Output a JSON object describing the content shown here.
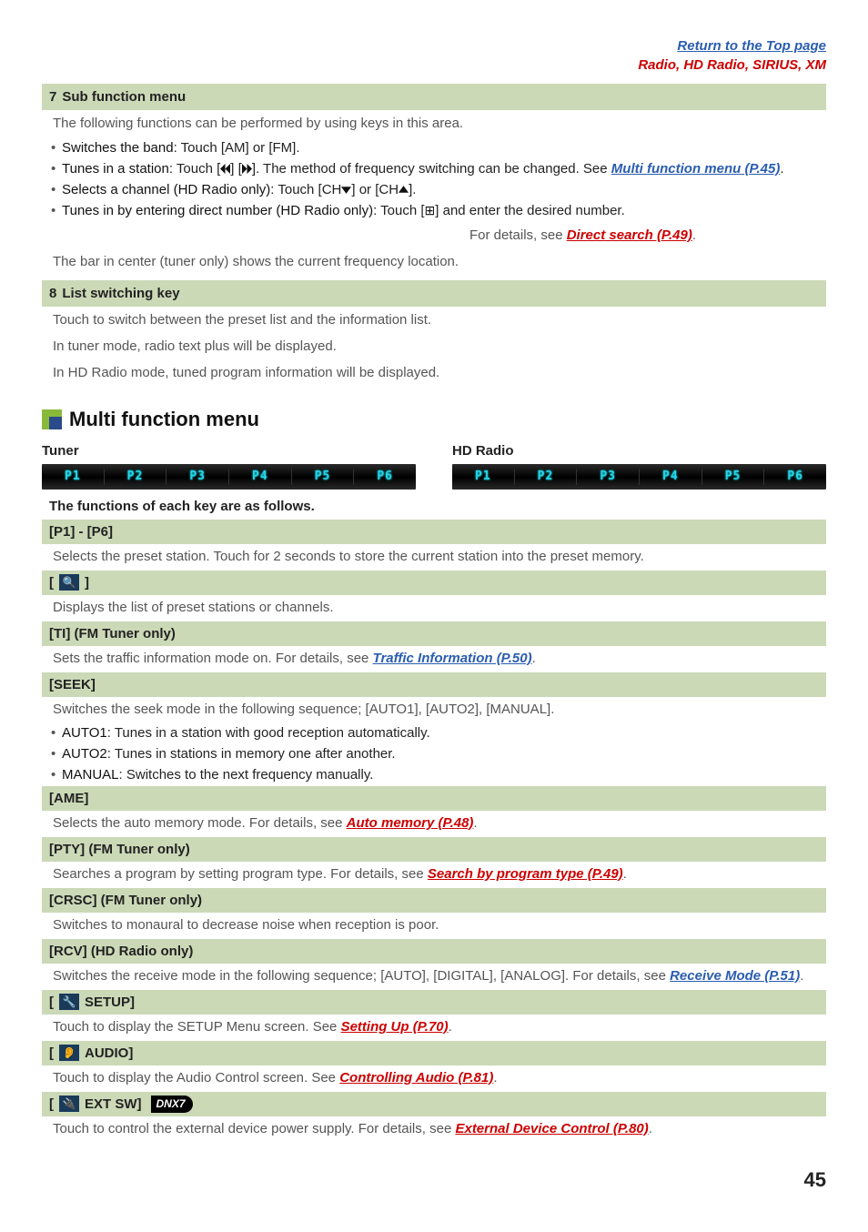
{
  "top": {
    "return": "Return to the Top page",
    "radio": "Radio, HD Radio, SIRIUS, XM"
  },
  "sec7": {
    "num": "7",
    "title": "Sub function menu",
    "intro": "The following functions can be performed by using keys in this area.",
    "b1_label": "Switches the band",
    "b1_text": ": Touch [AM] or [FM].",
    "b2_label": "Tunes in a station",
    "b2_text_a": ": Touch [",
    "b2_text_b": "] [",
    "b2_text_c": "]. The method of frequency switching can be changed. See ",
    "b2_link": "Multi function menu (P.45)",
    "b3_label": "Selects a channel (HD Radio only)",
    "b3_text_a": ": Touch [CH",
    "b3_text_b": "] or [CH",
    "b3_text_c": "].",
    "b4_label": "Tunes in by entering direct number (HD Radio only)",
    "b4_text_a": ": Touch [",
    "b4_text_b": "] and enter the desired number.",
    "b4_detail": "For details, see ",
    "b4_link": "Direct search (P.49)",
    "bar_note": "The bar in center (tuner only) shows the current frequency location."
  },
  "sec8": {
    "num": "8",
    "title": "List switching key",
    "l1": "Touch to switch between the preset list and the information list.",
    "l2": "In tuner mode, radio text plus will be displayed.",
    "l3": "In HD Radio mode, tuned program information will be displayed."
  },
  "mfm": {
    "title": "Multi function menu",
    "tuner": "Tuner",
    "hd": "HD Radio",
    "presets": [
      "P1",
      "P2",
      "P3",
      "P4",
      "P5",
      "P6"
    ],
    "func_note": "The functions of each key are as follows."
  },
  "keys": {
    "p1p6": {
      "hdr": "[P1] - [P6]",
      "body": "Selects the preset station. Touch for 2 seconds to store the current station into the preset memory."
    },
    "search": {
      "hdr_a": "[",
      "hdr_b": "]",
      "body": "Displays the list of preset stations or channels."
    },
    "ti": {
      "hdr": "[TI] (FM Tuner only)",
      "body_a": "Sets the traffic information mode on. For details, see ",
      "link": "Traffic Information (P.50)",
      "body_b": "."
    },
    "seek": {
      "hdr": "[SEEK]",
      "intro": "Switches the seek mode in the following sequence; [AUTO1], [AUTO2], [MANUAL].",
      "a1_label": "AUTO1",
      "a1_text": ": Tunes in a station with good reception automatically.",
      "a2_label": "AUTO2",
      "a2_text": ": Tunes in stations in memory one after another.",
      "a3_label": "MANUAL",
      "a3_text": ": Switches to the next frequency manually."
    },
    "ame": {
      "hdr": "[AME]",
      "body_a": "Selects the auto memory mode. For details, see ",
      "link": "Auto memory (P.48)",
      "body_b": "."
    },
    "pty": {
      "hdr": "[PTY] (FM Tuner only)",
      "body_a": "Searches a program by setting program type. For details, see ",
      "link": "Search by program type (P.49)",
      "body_b": "."
    },
    "crsc": {
      "hdr": "[CRSC] (FM Tuner only)",
      "body": "Switches to monaural to decrease noise when reception is poor."
    },
    "rcv": {
      "hdr": "[RCV] (HD Radio only)",
      "body_a": "Switches the receive mode in the following sequence; [AUTO], [DIGITAL], [ANALOG]. For details, see ",
      "link": "Receive Mode (P.51)",
      "body_b": "."
    },
    "setup": {
      "hdr_a": "[",
      "hdr_b": "SETUP]",
      "body_a": "Touch to display the SETUP Menu screen. See ",
      "link": "Setting Up (P.70)",
      "body_b": "."
    },
    "audio": {
      "hdr_a": "[",
      "hdr_b": "AUDIO]",
      "body_a": "Touch to display the Audio Control screen. See ",
      "link": "Controlling Audio (P.81)",
      "body_b": "."
    },
    "ext": {
      "hdr_a": "[",
      "hdr_b": "EXT SW]",
      "dnx": "DNX7",
      "body_a": "Touch to control the external device power supply. For details, see ",
      "link": "External Device Control (P.80)",
      "body_b": "."
    }
  },
  "page": "45"
}
